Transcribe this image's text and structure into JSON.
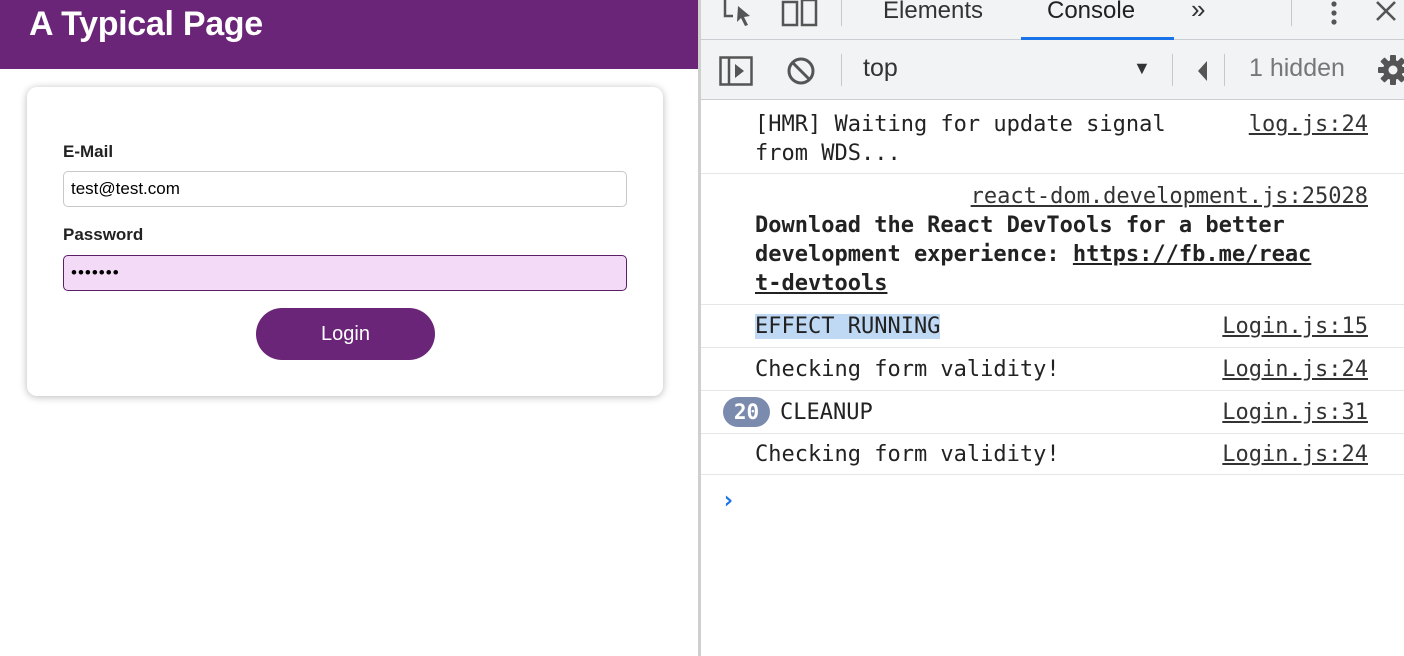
{
  "page": {
    "title": "A Typical Page",
    "email_label": "E-Mail",
    "email_value": "test@test.com",
    "password_label": "Password",
    "password_value": "•••••••",
    "login_label": "Login"
  },
  "devtools": {
    "tabs": [
      "Elements",
      "Console"
    ],
    "active_tab": "Console",
    "more_tabs_label": "»",
    "context": "top",
    "hidden_count": "1 hidden",
    "accent_color": "#1a73e8",
    "icons": [
      "inspect-element-icon",
      "device-toolbar-icon",
      "kebab-menu-icon",
      "close-icon",
      "sidebar-toggle-icon",
      "clear-console-icon",
      "settings-gear-icon"
    ],
    "log": [
      {
        "message": "[HMR] Waiting for update signal\nfrom WDS...",
        "source": "log.js:24"
      },
      {
        "message_plain": "Download the React DevTools for a better\ndevelopment experience: ",
        "message_link": "https://fb.me/reac\nt-devtools",
        "source": "react-dom.development.js:25028"
      },
      {
        "message": "EFFECT RUNNING",
        "source": "Login.js:15"
      },
      {
        "message": "Checking form validity!",
        "source": "Login.js:24"
      },
      {
        "count": "20",
        "message": "CLEANUP",
        "source": "Login.js:31"
      },
      {
        "message": "Checking form validity!",
        "source": "Login.js:24"
      }
    ],
    "prompt": "›"
  }
}
